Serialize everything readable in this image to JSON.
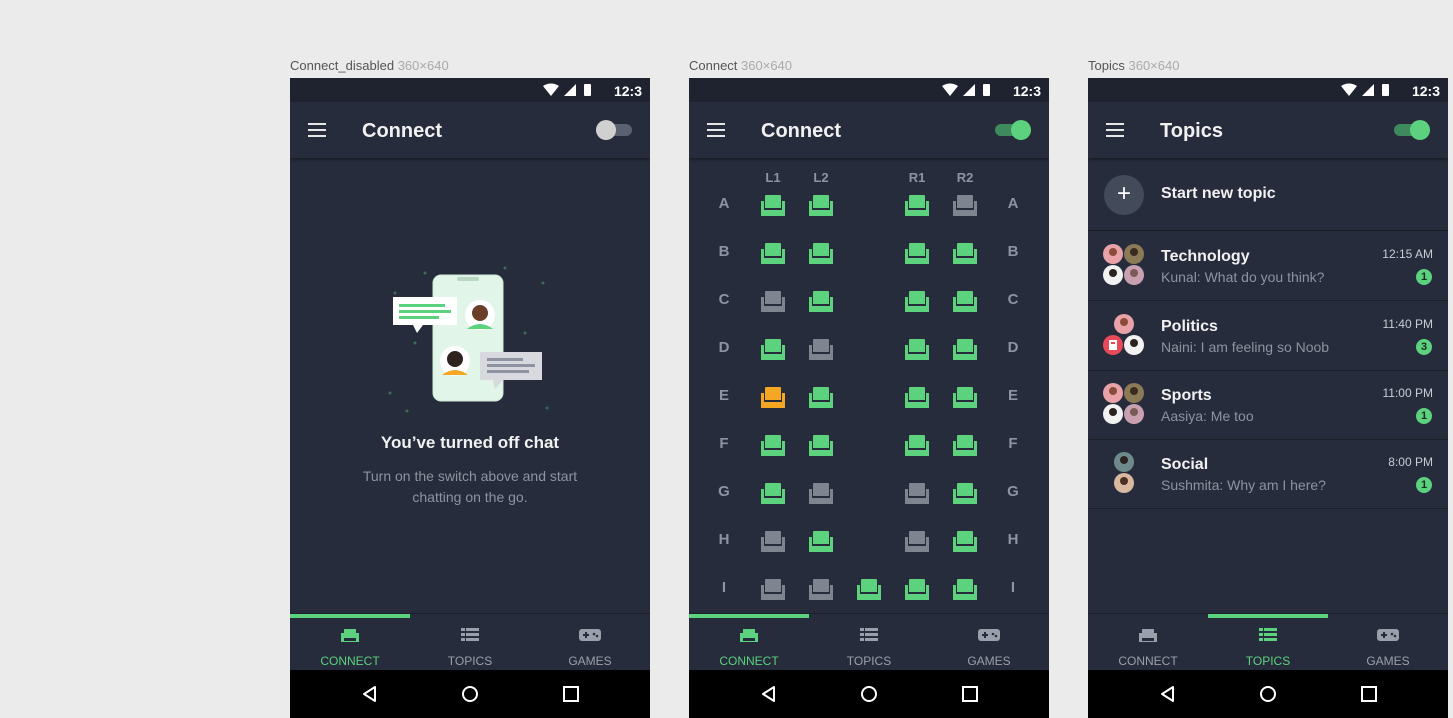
{
  "status_time": "12:3",
  "screens": [
    {
      "label": "Connect_disabled",
      "dim": "360×640",
      "title": "Connect"
    },
    {
      "label": "Connect",
      "dim": "360×640",
      "title": "Connect"
    },
    {
      "label": "Topics",
      "dim": "360×640",
      "title": "Topics"
    }
  ],
  "toggles": {
    "disabled": "off",
    "connect": "on",
    "topics": "on"
  },
  "empty": {
    "title": "You’ve turned off chat",
    "line1": "Turn on the switch above and start",
    "line2": "chatting on the go."
  },
  "seat_columns": [
    "L1",
    "L2",
    "R1",
    "R2"
  ],
  "seat_rows": [
    {
      "label": "A",
      "seats": [
        "available",
        "available",
        "",
        "available",
        "taken"
      ]
    },
    {
      "label": "B",
      "seats": [
        "available",
        "available",
        "",
        "available",
        "available"
      ]
    },
    {
      "label": "C",
      "seats": [
        "taken",
        "available",
        "",
        "available",
        "available"
      ]
    },
    {
      "label": "D",
      "seats": [
        "available",
        "taken",
        "",
        "available",
        "available"
      ]
    },
    {
      "label": "E",
      "seats": [
        "selected",
        "available",
        "",
        "available",
        "available"
      ]
    },
    {
      "label": "F",
      "seats": [
        "available",
        "available",
        "",
        "available",
        "available"
      ]
    },
    {
      "label": "G",
      "seats": [
        "available",
        "taken",
        "",
        "taken",
        "available"
      ]
    },
    {
      "label": "H",
      "seats": [
        "taken",
        "available",
        "",
        "taken",
        "available"
      ]
    },
    {
      "label": "I",
      "seats": [
        "taken",
        "taken",
        "available",
        "available",
        "available"
      ]
    }
  ],
  "seat_colors": {
    "available": "#5cd17e",
    "taken": "#7f8491",
    "selected": "#f5a623"
  },
  "new_topic_label": "Start new topic",
  "topics": [
    {
      "name": "Technology",
      "message": "Kunal: What do you think?",
      "time": "12:15 AM",
      "badge": "1"
    },
    {
      "name": "Politics",
      "message": "Naini: I am feeling so Noob",
      "time": "11:40 PM",
      "badge": "3"
    },
    {
      "name": "Sports",
      "message": "Aasiya: Me too",
      "time": "11:00 PM",
      "badge": "1"
    },
    {
      "name": "Social",
      "message": "Sushmita: Why am I here?",
      "time": "8:00 PM",
      "badge": "1"
    }
  ],
  "nav": {
    "connect": "CONNECT",
    "topics": "TOPICS",
    "games": "GAMES"
  },
  "colors": {
    "accent": "#5cd17e",
    "background": "#262c3b"
  }
}
